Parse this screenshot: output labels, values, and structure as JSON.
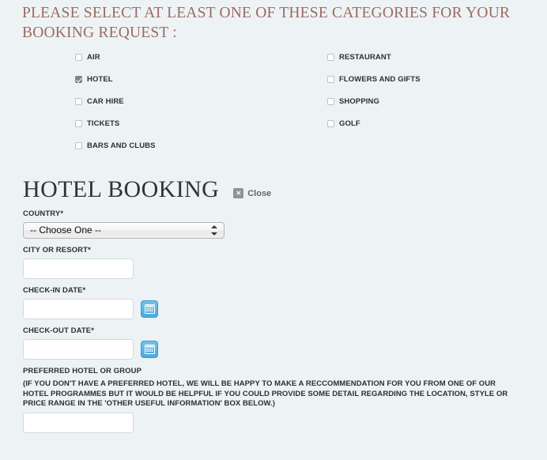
{
  "page": {
    "background_color": "#edf3f5",
    "heading": "PLEASE SELECT AT LEAST ONE OF THESE CATEGORIES FOR YOUR\nBOOKING REQUEST :",
    "heading_color": "#9c6a62"
  },
  "categories": {
    "left_column": [
      {
        "label": "AIR",
        "checked": false
      },
      {
        "label": "HOTEL",
        "checked": true
      },
      {
        "label": "CAR HIRE",
        "checked": false
      },
      {
        "label": "TICKETS",
        "checked": false
      },
      {
        "label": "BARS AND CLUBS",
        "checked": false
      }
    ],
    "right_column": [
      {
        "label": "RESTAURANT",
        "checked": false
      },
      {
        "label": "FLOWERS AND GIFTS",
        "checked": false
      },
      {
        "label": "SHOPPING",
        "checked": false
      },
      {
        "label": "GOLF",
        "checked": false
      }
    ]
  },
  "booking_form": {
    "title": "HOTEL BOOKING",
    "close_label": "Close",
    "close_icon": "x-icon",
    "fields": {
      "country": {
        "label": "COUNTRY*",
        "selected": "-- Choose One --",
        "options": [
          "-- Choose One --"
        ]
      },
      "city_or_resort": {
        "label": "CITY OR RESORT*",
        "value": "",
        "placeholder": ""
      },
      "check_in_date": {
        "label": "CHECK-IN DATE*",
        "value": "",
        "placeholder": "",
        "calendar_icon": "calendar-icon"
      },
      "check_out_date": {
        "label": "CHECK-OUT DATE*",
        "value": "",
        "placeholder": "",
        "calendar_icon": "calendar-icon"
      },
      "preferred_hotel": {
        "label": "PREFERRED HOTEL OR GROUP",
        "note": "(IF YOU DON'T HAVE A PREFERRED HOTEL, WE WILL BE HAPPY TO MAKE A RECCOMMENDATION FOR YOU FROM ONE OF OUR\nHOTEL PROGRAMMES BUT IT WOULD BE HELPFUL IF YOU COULD PROVIDE SOME DETAIL REGARDING THE LOCATION, STYLE OR\nPRICE RANGE IN THE 'OTHER USEFUL INFORMATION' BOX BELOW.)",
        "value": "",
        "placeholder": ""
      }
    }
  }
}
